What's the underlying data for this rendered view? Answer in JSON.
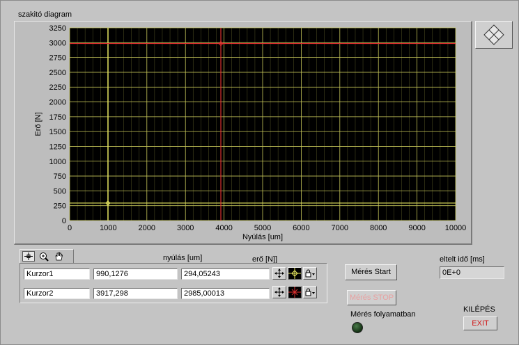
{
  "graph": {
    "title": "szakitó diagram",
    "xlabel": "Nyúlás  [um]",
    "ylabel": "Erő [N]",
    "bg_color": "#000000",
    "grid_color": "#c8c85a",
    "cursor1_color": "#e8e860",
    "cursor2_color": "#e03030",
    "scale_icon": "diamond-x-icon"
  },
  "chart_data": {
    "type": "line",
    "xlim": [
      0,
      10000
    ],
    "ylim": [
      0,
      3250
    ],
    "x_ticks": [
      0,
      1000,
      2000,
      3000,
      4000,
      5000,
      6000,
      7000,
      8000,
      9000,
      10000
    ],
    "y_ticks": [
      0,
      250,
      500,
      750,
      1000,
      1250,
      1500,
      1750,
      2000,
      2250,
      2500,
      2750,
      3000,
      3250
    ],
    "x_minor_step": 200,
    "grid": true,
    "series": [],
    "cursors": [
      {
        "name": "Kurzor1",
        "x": 990.1276,
        "y": 294.05243,
        "color": "#e8e860"
      },
      {
        "name": "Kurzor2",
        "x": 3917.298,
        "y": 2985.00013,
        "color": "#e03030"
      }
    ]
  },
  "cursor_table": {
    "header_x": "nyúlás [um]",
    "header_y": "erő [N]]",
    "rows": [
      {
        "name": "Kurzor1",
        "x": "990,1276",
        "y": "294,05243"
      },
      {
        "name": "Kurzor2",
        "x": "3917,298",
        "y": "2985,00013"
      }
    ],
    "tools": [
      "cursor-move-icon",
      "zoom-icon",
      "hand-pan-icon"
    ]
  },
  "controls": {
    "start_label": "Mérés Start",
    "stop_label": "Mérés STOP",
    "running_label": "Mérés folyamatban",
    "elapsed_label": "eltelt idő [ms]",
    "elapsed_value": "0E+0",
    "exit_caption": "KILÉPÉS",
    "exit_label": "EXIT"
  }
}
